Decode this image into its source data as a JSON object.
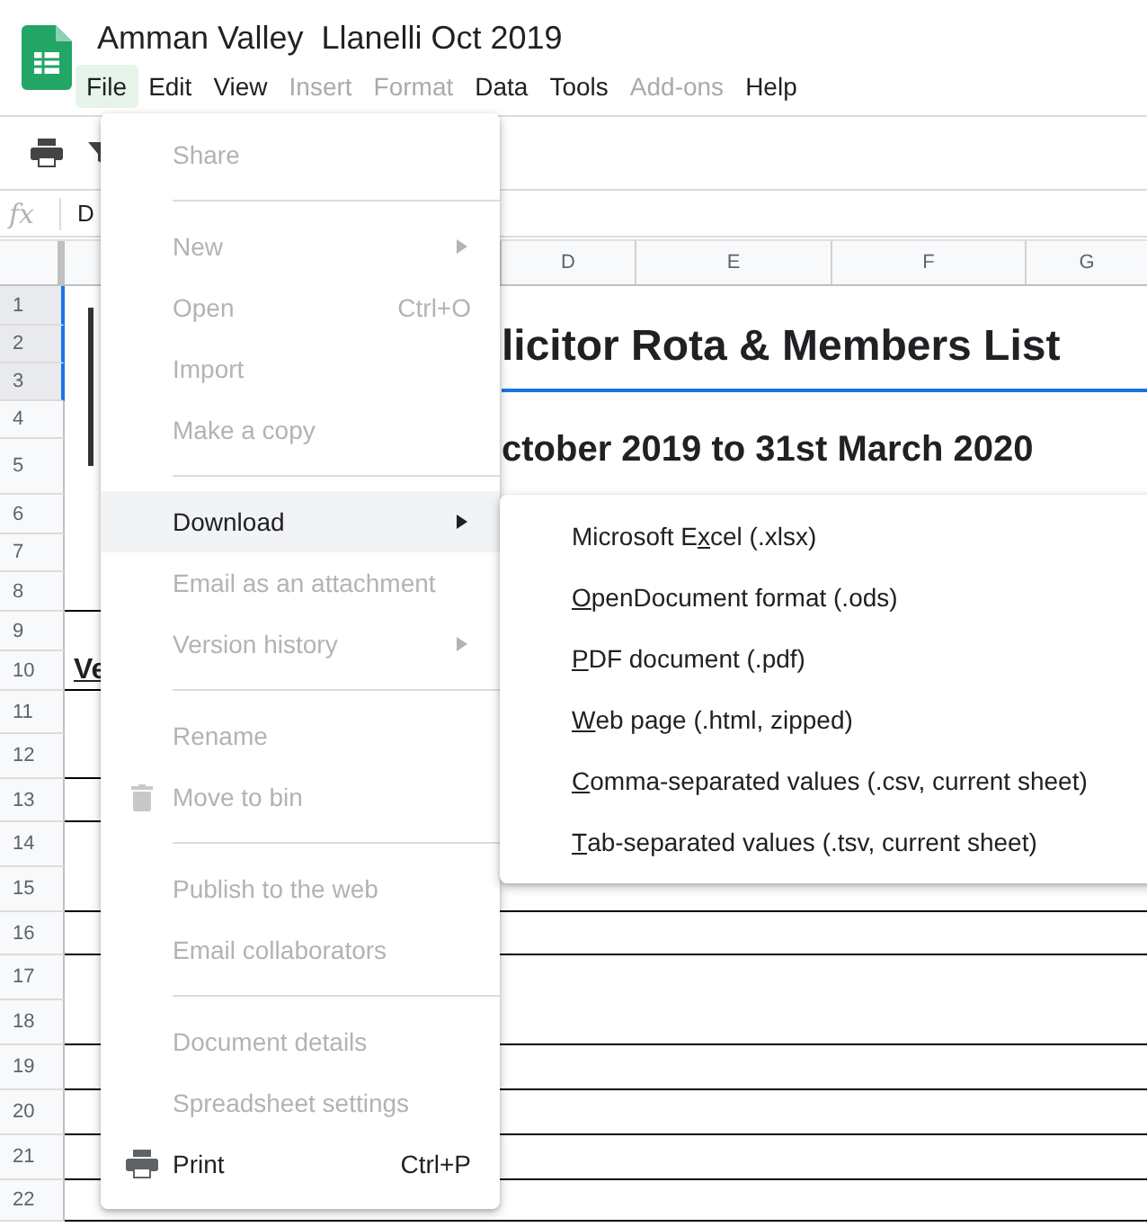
{
  "app": {
    "title": "Amman Valley  Llanelli Oct 2019"
  },
  "menubar": [
    {
      "label": "File",
      "selected": true,
      "disabled": false
    },
    {
      "label": "Edit",
      "selected": false,
      "disabled": false
    },
    {
      "label": "View",
      "selected": false,
      "disabled": false
    },
    {
      "label": "Insert",
      "selected": false,
      "disabled": true
    },
    {
      "label": "Format",
      "selected": false,
      "disabled": true
    },
    {
      "label": "Data",
      "selected": false,
      "disabled": false
    },
    {
      "label": "Tools",
      "selected": false,
      "disabled": false
    },
    {
      "label": "Add-ons",
      "selected": false,
      "disabled": true
    },
    {
      "label": "Help",
      "selected": false,
      "disabled": false
    }
  ],
  "formula_bar": {
    "label": "fx",
    "content": "D"
  },
  "columns": [
    "D",
    "E",
    "F",
    "G"
  ],
  "rows": [
    {
      "number": "1",
      "selected": true,
      "bottom_border": false
    },
    {
      "number": "2",
      "selected": true,
      "bottom_border": false
    },
    {
      "number": "3",
      "selected": true,
      "bottom_border": false
    },
    {
      "number": "4",
      "selected": false,
      "bottom_border": false
    },
    {
      "number": "5",
      "selected": false,
      "bottom_border": false
    },
    {
      "number": "6",
      "selected": false,
      "bottom_border": false
    },
    {
      "number": "7",
      "selected": false,
      "bottom_border": false
    },
    {
      "number": "8",
      "selected": false,
      "bottom_border": true
    },
    {
      "number": "9",
      "selected": false,
      "bottom_border": false
    },
    {
      "number": "10",
      "selected": false,
      "bottom_border": true
    },
    {
      "number": "11",
      "selected": false,
      "bottom_border": false
    },
    {
      "number": "12",
      "selected": false,
      "bottom_border": true
    },
    {
      "number": "13",
      "selected": false,
      "bottom_border": true
    },
    {
      "number": "14",
      "selected": false,
      "bottom_border": false
    },
    {
      "number": "15",
      "selected": false,
      "bottom_border": true
    },
    {
      "number": "16",
      "selected": false,
      "bottom_border": true
    },
    {
      "number": "17",
      "selected": false,
      "bottom_border": false
    },
    {
      "number": "18",
      "selected": false,
      "bottom_border": true
    },
    {
      "number": "19",
      "selected": false,
      "bottom_border": true
    },
    {
      "number": "20",
      "selected": false,
      "bottom_border": true
    },
    {
      "number": "21",
      "selected": false,
      "bottom_border": true
    },
    {
      "number": "22",
      "selected": false,
      "bottom_border": true
    }
  ],
  "sheet": {
    "title": "licitor Rota & Members List",
    "subtitle": "ctober 2019 to 31st March 2020",
    "cell_text": "Ve"
  },
  "file_menu": {
    "items": [
      {
        "kind": "item",
        "label": "Share",
        "disabled": true,
        "selected": false
      },
      {
        "kind": "divider"
      },
      {
        "kind": "item",
        "label": "New",
        "disabled": true,
        "selected": false,
        "submenu": true
      },
      {
        "kind": "item",
        "label": "Open",
        "disabled": true,
        "selected": false,
        "shortcut": "Ctrl+O"
      },
      {
        "kind": "item",
        "label": "Import",
        "disabled": true,
        "selected": false
      },
      {
        "kind": "item",
        "label": "Make a copy",
        "disabled": true,
        "selected": false
      },
      {
        "kind": "divider"
      },
      {
        "kind": "item",
        "label": "Download",
        "disabled": false,
        "selected": true,
        "submenu": true
      },
      {
        "kind": "item",
        "label": "Email as an attachment",
        "disabled": true,
        "selected": false
      },
      {
        "kind": "item",
        "label": "Version history",
        "disabled": true,
        "selected": false,
        "submenu": true
      },
      {
        "kind": "divider"
      },
      {
        "kind": "item",
        "label": "Rename",
        "disabled": true,
        "selected": false
      },
      {
        "kind": "bin",
        "label": "Move to bin",
        "disabled": true,
        "selected": false
      },
      {
        "kind": "divider"
      },
      {
        "kind": "item",
        "label": "Publish to the web",
        "disabled": true,
        "selected": false
      },
      {
        "kind": "item",
        "label": "Email collaborators",
        "disabled": true,
        "selected": false
      },
      {
        "kind": "divider"
      },
      {
        "kind": "item",
        "label": "Document details",
        "disabled": true,
        "selected": false
      },
      {
        "kind": "item",
        "label": "Spreadsheet settings",
        "disabled": true,
        "selected": false
      },
      {
        "kind": "print",
        "label": "Print",
        "disabled": false,
        "selected": false,
        "shortcut": "Ctrl+P"
      }
    ]
  },
  "download_menu": {
    "items": [
      {
        "before": "Microsoft E",
        "mnemonic": "x",
        "after": "cel (.xlsx)"
      },
      {
        "mnemonic": "O",
        "after": "penDocument format (.ods)"
      },
      {
        "mnemonic": "P",
        "after": "DF document (.pdf)"
      },
      {
        "mnemonic": "W",
        "after": "eb page (.html, zipped)"
      },
      {
        "mnemonic": "C",
        "after": "omma-separated values (.csv, current sheet)"
      },
      {
        "mnemonic": "T",
        "after": "ab-separated values (.tsv, current sheet)"
      }
    ]
  }
}
